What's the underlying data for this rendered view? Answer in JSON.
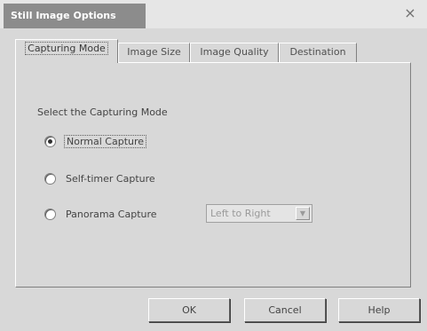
{
  "window": {
    "title": "Still Image Options",
    "close_glyph": "×"
  },
  "tabs": [
    {
      "label": "Capturing Mode",
      "active": true
    },
    {
      "label": "Image Size",
      "active": false
    },
    {
      "label": "Image Quality",
      "active": false
    },
    {
      "label": "Destination",
      "active": false
    }
  ],
  "mode_group": {
    "label": "Select the Capturing Mode",
    "options": [
      {
        "label": "Normal Capture",
        "selected": true
      },
      {
        "label": "Self-timer Capture",
        "selected": false
      },
      {
        "label": "Panorama Capture",
        "selected": false
      }
    ],
    "panorama_direction": {
      "value": "Left to Right",
      "enabled": false,
      "arrow_glyph": "▼"
    }
  },
  "buttons": {
    "ok": "OK",
    "cancel": "Cancel",
    "help": "Help"
  }
}
